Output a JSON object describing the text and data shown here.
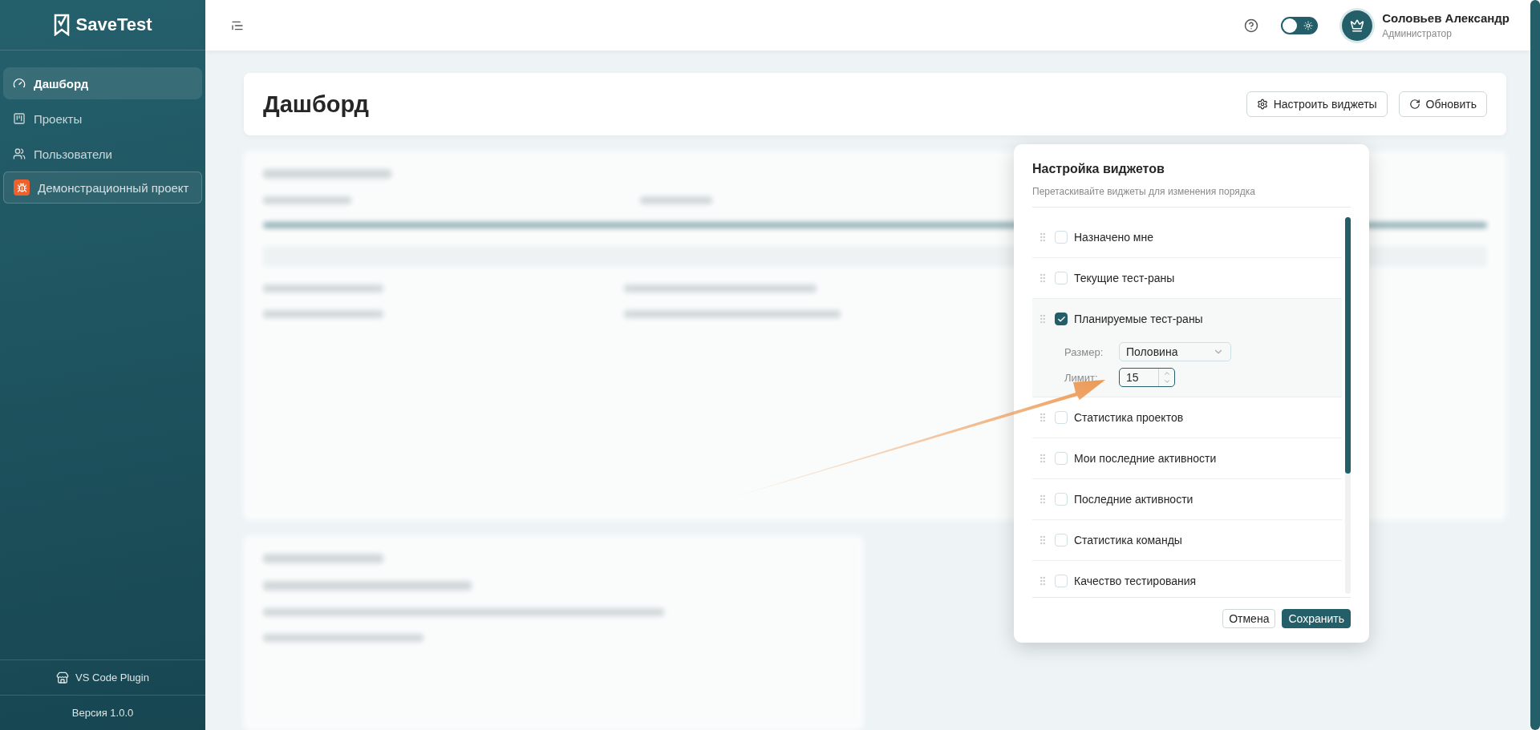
{
  "sidebar": {
    "logo": "SaveTest",
    "items": [
      {
        "label": "Дашборд",
        "selected": true
      },
      {
        "label": "Проекты",
        "selected": false
      },
      {
        "label": "Пользователи",
        "selected": false
      }
    ],
    "project": "Демонстрационный проект",
    "plugin": "VS Code Plugin",
    "version": "Версия 1.0.0"
  },
  "header": {
    "theme_toggle": {
      "on": false
    },
    "user": {
      "name": "Соловьев Александр",
      "role": "Администратор"
    }
  },
  "page": {
    "title": "Дашборд",
    "buttons": [
      {
        "label": "Настроить виджеты",
        "kind": "settings"
      },
      {
        "label": "Обновить",
        "kind": "refresh"
      }
    ]
  },
  "popover": {
    "title": "Настройка виджетов",
    "subtitle": "Перетаскивайте виджеты для изменения порядка",
    "widgets": [
      {
        "label": "Назначено мне",
        "checked": false
      },
      {
        "label": "Текущие тест-раны",
        "checked": false
      },
      {
        "label": "Планируемые тест-раны",
        "checked": true,
        "size_label": "Размер:",
        "size": "Половина",
        "limit_label": "Лимит:",
        "limit": "15"
      },
      {
        "label": "Статистика проектов",
        "checked": false
      },
      {
        "label": "Мои последние активности",
        "checked": false
      },
      {
        "label": "Последние активности",
        "checked": false
      },
      {
        "label": "Статистика команды",
        "checked": false
      },
      {
        "label": "Качество тестирования",
        "checked": false
      }
    ],
    "buttons": [
      {
        "label": "Отмена",
        "kind": "secondary"
      },
      {
        "label": "Сохранить",
        "kind": "primary"
      }
    ]
  }
}
